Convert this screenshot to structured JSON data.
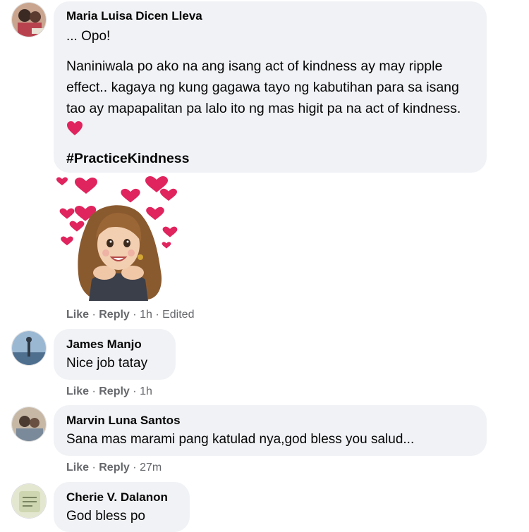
{
  "comments": [
    {
      "author": "Maria Luisa Dicen Lleva",
      "line1": "... Opo!",
      "para": "Naniniwala po ako na ang isang act of kindness ay may ripple effect.. kagaya ng kung gagawa tayo ng kabutihan para sa isang tao ay mapapalitan pa lalo ito ng mas higit pa na act of kindness.",
      "hashtag": "#PracticeKindness",
      "like": "Like",
      "reply": "Reply",
      "time": "1h",
      "edited": "Edited",
      "sep": "·"
    },
    {
      "author": "James Manjo",
      "text": "Nice job tatay",
      "like": "Like",
      "reply": "Reply",
      "time": "1h",
      "sep": "·"
    },
    {
      "author": "Marvin Luna Santos",
      "text": "Sana mas marami pang katulad nya,god bless you salud...",
      "like": "Like",
      "reply": "Reply",
      "time": "27m",
      "sep": "·"
    },
    {
      "author": "Cherie V. Dalanon",
      "text": "God bless po"
    }
  ],
  "colors": {
    "bubble": "#f0f2f5",
    "meta": "#65676b",
    "heart": "#e0245e"
  },
  "icons": {
    "emoji": "red-heart-icon",
    "sticker": "hearts-avatar-sticker"
  }
}
